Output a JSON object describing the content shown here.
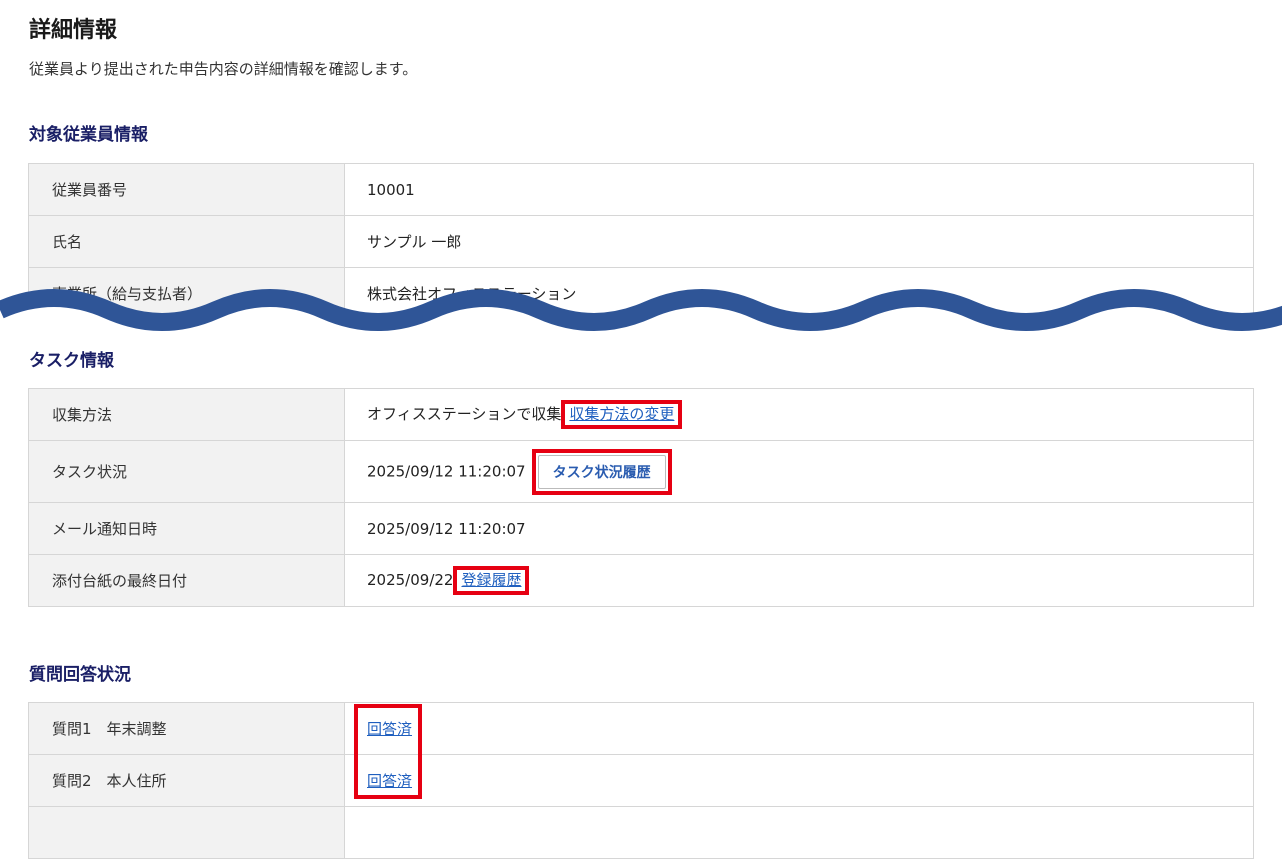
{
  "page": {
    "title": "詳細情報",
    "description": "従業員より提出された申告内容の詳細情報を確認します。"
  },
  "employee_section": {
    "title": "対象従業員情報",
    "rows": [
      {
        "label": "従業員番号",
        "value": "10001"
      },
      {
        "label": "氏名",
        "value": "サンプル 一郎"
      },
      {
        "label": "事業所（給与支払者）",
        "value": "株式会社オフィスステーション"
      }
    ]
  },
  "task_section": {
    "title": "タスク情報",
    "collection": {
      "label": "収集方法",
      "value": "オフィスステーションで収集",
      "link": "収集方法の変更"
    },
    "status": {
      "label": "タスク状況",
      "value": "2025/09/12 11:20:07",
      "button": "タスク状況履歴"
    },
    "mail": {
      "label": "メール通知日時",
      "value": "2025/09/12 11:20:07"
    },
    "attachment": {
      "label": "添付台紙の最終日付",
      "value": "2025/09/22",
      "link": "登録履歴"
    }
  },
  "qa_section": {
    "title": "質問回答状況",
    "rows": [
      {
        "label": "質問1　年末調整",
        "status": "回答済"
      },
      {
        "label": "質問2　本人住所",
        "status": "回答済"
      }
    ]
  },
  "colors": {
    "accent_red": "#e60012",
    "section_title": "#1a1f66",
    "link": "#1f5fbf",
    "wave": "#2f5597"
  },
  "icons": {
    "wave_break": "wave-break-icon"
  }
}
